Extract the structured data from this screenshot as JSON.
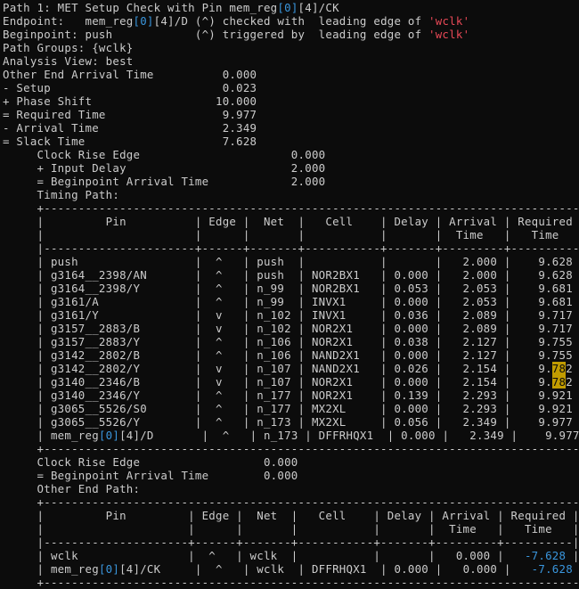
{
  "lines": [
    [
      {
        "t": "Path 1: MET Setup Check with Pin mem_reg"
      },
      {
        "t": "[0]",
        "c": "cy"
      },
      {
        "t": "[4]/CK"
      }
    ],
    [
      {
        "t": "Endpoint:   mem_reg"
      },
      {
        "t": "[0]",
        "c": "cy"
      },
      {
        "t": "[4]/D (^) checked with  leading edge of "
      },
      {
        "t": "'wclk'",
        "c": "rd"
      }
    ],
    [
      {
        "t": "Beginpoint: push            (^) triggered by  leading edge of "
      },
      {
        "t": "'wclk'",
        "c": "rd"
      }
    ],
    [
      {
        "t": "Path Groups: {wclk}"
      }
    ],
    [
      {
        "t": "Analysis View: best"
      }
    ],
    [
      {
        "t": "Other End Arrival Time          0.000"
      }
    ],
    [
      {
        "t": "- Setup                         0.023"
      }
    ],
    [
      {
        "t": "+ Phase Shift                  10.000"
      }
    ],
    [
      {
        "t": "= Required Time                 9.977"
      }
    ],
    [
      {
        "t": "- Arrival Time                  2.349"
      }
    ],
    [
      {
        "t": "= Slack Time                    7.628"
      }
    ],
    [
      {
        "t": "     Clock Rise Edge                      0.000"
      }
    ],
    [
      {
        "t": "     + Input Delay                        2.000"
      }
    ],
    [
      {
        "t": "     = Beginpoint Arrival Time            2.000"
      }
    ],
    [
      {
        "t": "     Timing Path:"
      }
    ],
    [
      {
        "t": "     +--------------------------------------------------------------------------------+"
      }
    ],
    [
      {
        "t": "     |         Pin          | Edge |  Net  |   Cell    | Delay | Arrival | Required |"
      }
    ],
    [
      {
        "t": "     |                      |      |       |           |       |  Time   |   Time   |"
      }
    ],
    [
      {
        "t": "     |----------------------+------+-------+-----------+-------+---------+----------|"
      }
    ],
    [
      {
        "t": "     | push                 |  ^   | push  |           |       |   2.000 |    9.628 |"
      }
    ],
    [
      {
        "t": "     | g3164__2398/AN       |  ^   | push  | NOR2BX1   | 0.000 |   2.000 |    9.628 |"
      }
    ],
    [
      {
        "t": "     | g3164__2398/Y        |  ^   | n_99  | NOR2BX1   | 0.053 |   2.053 |    9.681 |"
      }
    ],
    [
      {
        "t": "     | g3161/A              |  ^   | n_99  | INVX1     | 0.000 |   2.053 |    9.681 |"
      }
    ],
    [
      {
        "t": "     | g3161/Y              |  v   | n_102 | INVX1     | 0.036 |   2.089 |    9.717 |"
      }
    ],
    [
      {
        "t": "     | g3157__2883/B        |  v   | n_102 | NOR2X1    | 0.000 |   2.089 |    9.717 |"
      }
    ],
    [
      {
        "t": "     | g3157__2883/Y        |  ^   | n_106 | NOR2X1    | 0.038 |   2.127 |    9.755 |"
      }
    ],
    [
      {
        "t": "     | g3142__2802/B        |  ^   | n_106 | NAND2X1   | 0.000 |   2.127 |    9.755 |"
      }
    ],
    [
      {
        "t": "     | g3142__2802/Y        |  v   | n_107 | NAND2X1   | 0.026 |   2.154 |    9."
      },
      {
        "t": "78",
        "c": "hl"
      },
      {
        "t": "2 |"
      }
    ],
    [
      {
        "t": "     | g3140__2346/B        |  v   | n_107 | NOR2X1    | 0.000 |   2.154 |    9."
      },
      {
        "t": "78",
        "c": "hl"
      },
      {
        "t": "2 |"
      }
    ],
    [
      {
        "t": "     | g3140__2346/Y        |  ^   | n_177 | NOR2X1    | 0.139 |   2.293 |    9.921 |"
      }
    ],
    [
      {
        "t": "     | g3065__5526/S0       |  ^   | n_177 | MX2XL     | 0.000 |   2.293 |    9.921 |"
      }
    ],
    [
      {
        "t": "     | g3065__5526/Y        |  ^   | n_173 | MX2XL     | 0.056 |   2.349 |    9.977 |"
      }
    ],
    [
      {
        "t": "     | mem_reg"
      },
      {
        "t": "[0]",
        "c": "cy"
      },
      {
        "t": "[4]/D       |  ^   | n_173 | DFFRHQX1  | 0.000 |   2.349 |    9.977 |"
      }
    ],
    [
      {
        "t": "     +--------------------------------------------------------------------------------+"
      }
    ],
    [
      {
        "t": "     Clock Rise Edge                  0.000"
      }
    ],
    [
      {
        "t": "     = Beginpoint Arrival Time        0.000"
      }
    ],
    [
      {
        "t": "     Other End Path:"
      }
    ],
    [
      {
        "t": "     +--------------------------------------------------------------------------------+"
      }
    ],
    [
      {
        "t": "     |         Pin         | Edge |  Net  |   Cell    | Delay | Arrival | Required |"
      }
    ],
    [
      {
        "t": "     |                     |      |       |           |       |  Time   |   Time   |"
      }
    ],
    [
      {
        "t": "     |---------------------+------+-------+-----------+-------+---------+----------|"
      }
    ],
    [
      {
        "t": "     | wclk                |  ^   | wclk  |           |       |   0.000 |   "
      },
      {
        "t": "-7.628",
        "c": "cy"
      },
      {
        "t": " |"
      }
    ],
    [
      {
        "t": "     | mem_reg"
      },
      {
        "t": "[0]",
        "c": "cy"
      },
      {
        "t": "[4]/CK     |  ^   | wclk  | DFFRHQX1  | 0.000 |   0.000 |   "
      },
      {
        "t": "-7.628",
        "c": "cy"
      },
      {
        "t": " |"
      }
    ],
    [
      {
        "t": "     +--------------------------------------------------------------------------------+"
      }
    ]
  ]
}
